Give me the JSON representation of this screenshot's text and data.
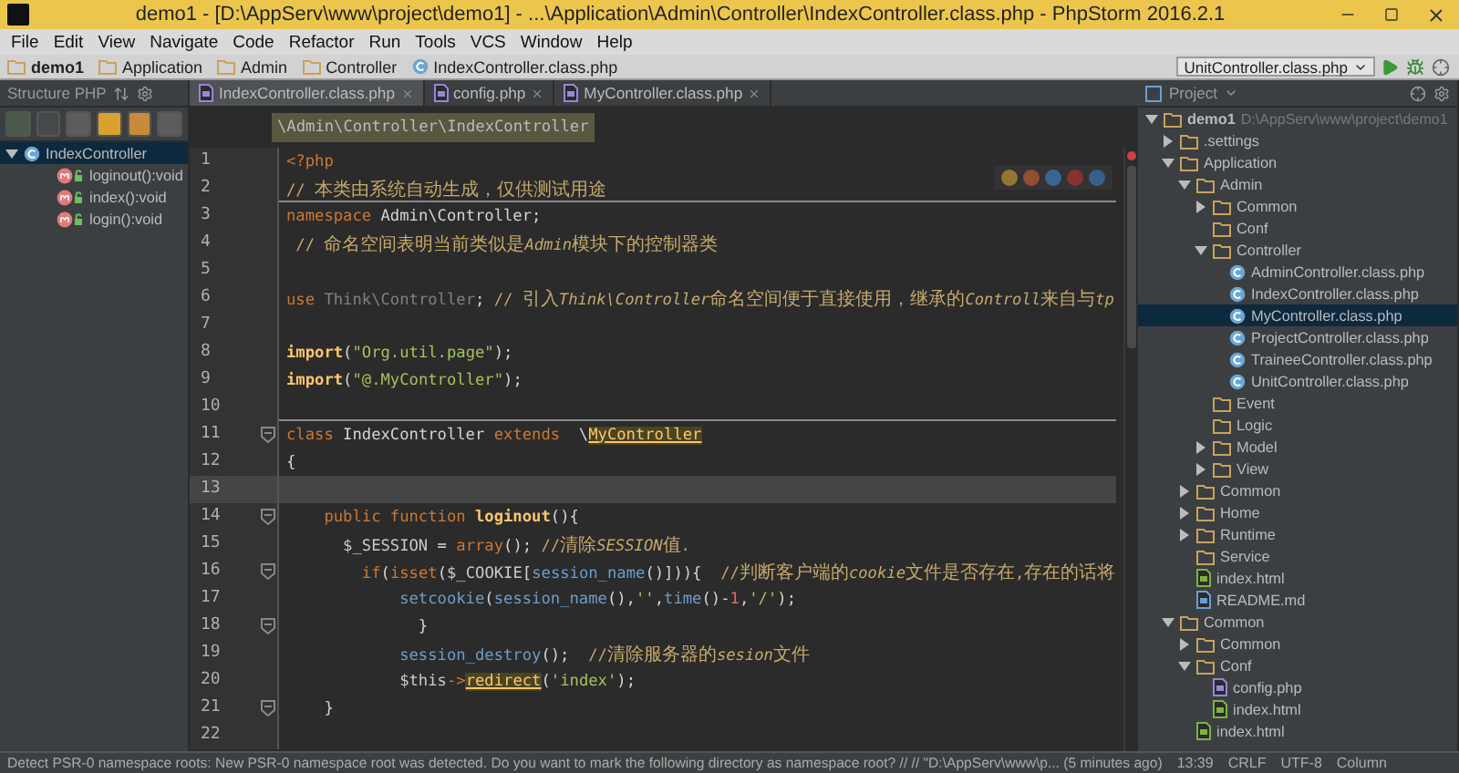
{
  "window": {
    "title": "demo1 - [D:\\AppServ\\www\\project\\demo1] - ...\\Application\\Admin\\Controller\\IndexController.class.php - PhpStorm 2016.2.1"
  },
  "menu": [
    "File",
    "Edit",
    "View",
    "Navigate",
    "Code",
    "Refactor",
    "Run",
    "Tools",
    "VCS",
    "Window",
    "Help"
  ],
  "navbar": {
    "crumbs": [
      {
        "label": "demo1",
        "kind": "project"
      },
      {
        "label": "Application",
        "kind": "folder"
      },
      {
        "label": "Admin",
        "kind": "folder"
      },
      {
        "label": "Controller",
        "kind": "folder"
      },
      {
        "label": "IndexController.class.php",
        "kind": "class"
      }
    ],
    "run_config": "UnitController.class.php"
  },
  "structure": {
    "title": "Structure PHP",
    "tree": [
      {
        "label": "IndexController",
        "kind": "class",
        "selected": true,
        "expanded": true,
        "children": [
          {
            "label": "loginout():void",
            "kind": "method",
            "selected": false
          },
          {
            "label": "index():void",
            "kind": "method",
            "selected": false
          },
          {
            "label": "login():void",
            "kind": "method",
            "selected": false
          }
        ]
      }
    ]
  },
  "editor": {
    "tabs": [
      {
        "label": "IndexController.class.php",
        "selected": true
      },
      {
        "label": "config.php",
        "selected": false
      },
      {
        "label": "MyController.class.php",
        "selected": false
      }
    ],
    "breadcrumb": "\\Admin\\Controller\\IndexController",
    "lines": [
      {
        "number": "1",
        "current": false,
        "fold": false,
        "separator": false,
        "segments": [
          {
            "kind": "tag",
            "text": "<?php"
          }
        ]
      },
      {
        "number": "2",
        "current": false,
        "fold": false,
        "separator": true,
        "segments": [
          {
            "kind": "comment",
            "text": "// 本类由系统自动生成，仅供测试用途"
          }
        ]
      },
      {
        "number": "3",
        "current": false,
        "fold": false,
        "separator": false,
        "segments": [
          {
            "kind": "keyword",
            "text": "namespace"
          },
          {
            "kind": "plain",
            "text": " Admin\\Controller;"
          }
        ]
      },
      {
        "number": "4",
        "current": false,
        "fold": false,
        "separator": false,
        "segments": [
          {
            "kind": "comment",
            "text": " // 命名空间表明当前类似是"
          },
          {
            "kind": "comment_italic",
            "text": "Admin"
          },
          {
            "kind": "comment",
            "text": "模块下的控制器类"
          }
        ]
      },
      {
        "number": "5",
        "current": false,
        "fold": false,
        "separator": false
      },
      {
        "number": "6",
        "current": false,
        "fold": false,
        "separator": false,
        "segments": [
          {
            "kind": "keyword",
            "text": "use"
          },
          {
            "kind": "dim",
            "text": " Think\\Controller"
          },
          {
            "kind": "plain",
            "text": "; "
          },
          {
            "kind": "comment",
            "text": "// 引入"
          },
          {
            "kind": "comment_italic",
            "text": "Think\\Controller"
          },
          {
            "kind": "comment",
            "text": "命名空间便于直接使用，继承的"
          },
          {
            "kind": "comment_italic",
            "text": "Controll"
          },
          {
            "kind": "comment",
            "text": "来自与"
          },
          {
            "kind": "comment_italic",
            "text": "tp"
          }
        ]
      },
      {
        "number": "7",
        "current": false,
        "fold": false,
        "separator": false
      },
      {
        "number": "8",
        "current": false,
        "fold": false,
        "separator": false,
        "segments": [
          {
            "kind": "func",
            "text": "import"
          },
          {
            "kind": "plain",
            "text": "("
          },
          {
            "kind": "string",
            "text": "\"Org.util.page\""
          },
          {
            "kind": "plain",
            "text": ");"
          }
        ]
      },
      {
        "number": "9",
        "current": false,
        "fold": false,
        "separator": false,
        "segments": [
          {
            "kind": "func",
            "text": "import"
          },
          {
            "kind": "plain",
            "text": "("
          },
          {
            "kind": "string",
            "text": "\"@.MyController\""
          },
          {
            "kind": "plain",
            "text": ");"
          }
        ]
      },
      {
        "number": "10",
        "current": false,
        "fold": false,
        "separator": true
      },
      {
        "number": "11",
        "current": false,
        "fold": true,
        "separator": false,
        "segments": [
          {
            "kind": "keyword",
            "text": "class"
          },
          {
            "kind": "plain",
            "text": " IndexController "
          },
          {
            "kind": "keyword",
            "text": "extends"
          },
          {
            "kind": "plain",
            "text": "  \\"
          },
          {
            "kind": "ref",
            "text": "MyController"
          }
        ]
      },
      {
        "number": "12",
        "current": false,
        "fold": false,
        "separator": false,
        "segments": [
          {
            "kind": "plain",
            "text": "{"
          }
        ]
      },
      {
        "number": "13",
        "current": true,
        "fold": false,
        "separator": false
      },
      {
        "number": "14",
        "current": false,
        "fold": true,
        "separator": false,
        "segments": [
          {
            "kind": "keyword",
            "text": "    public function "
          },
          {
            "kind": "func",
            "text": "loginout"
          },
          {
            "kind": "plain",
            "text": "(){"
          }
        ]
      },
      {
        "number": "15",
        "current": false,
        "fold": false,
        "separator": false,
        "segments": [
          {
            "kind": "var",
            "text": "      $_SESSION"
          },
          {
            "kind": "plain",
            "text": " = "
          },
          {
            "kind": "keyword",
            "text": "array"
          },
          {
            "kind": "plain",
            "text": "(); "
          },
          {
            "kind": "comment",
            "text": "//清除"
          },
          {
            "kind": "comment_italic",
            "text": "SESSION"
          },
          {
            "kind": "comment",
            "text": "值."
          }
        ]
      },
      {
        "number": "16",
        "current": false,
        "fold": true,
        "separator": false,
        "segments": [
          {
            "kind": "keyword",
            "text": "        if"
          },
          {
            "kind": "plain",
            "text": "("
          },
          {
            "kind": "keyword",
            "text": "isset"
          },
          {
            "kind": "plain",
            "text": "("
          },
          {
            "kind": "var",
            "text": "$_COOKIE"
          },
          {
            "kind": "plain",
            "text": "["
          },
          {
            "kind": "builtin",
            "text": "session_name"
          },
          {
            "kind": "plain",
            "text": "()])){  "
          },
          {
            "kind": "comment",
            "text": "//判断客户端的"
          },
          {
            "kind": "comment_italic",
            "text": "cookie"
          },
          {
            "kind": "comment",
            "text": "文件是否存在,存在的话将"
          }
        ]
      },
      {
        "number": "17",
        "current": false,
        "fold": false,
        "separator": false,
        "segments": [
          {
            "kind": "builtin",
            "text": "            setcookie"
          },
          {
            "kind": "plain",
            "text": "("
          },
          {
            "kind": "builtin",
            "text": "session_name"
          },
          {
            "kind": "plain",
            "text": "(),"
          },
          {
            "kind": "string",
            "text": "''"
          },
          {
            "kind": "plain",
            "text": ","
          },
          {
            "kind": "builtin",
            "text": "time"
          },
          {
            "kind": "plain",
            "text": "()-"
          },
          {
            "kind": "number",
            "text": "1"
          },
          {
            "kind": "plain",
            "text": ","
          },
          {
            "kind": "string",
            "text": "'/'"
          },
          {
            "kind": "plain",
            "text": ");"
          }
        ]
      },
      {
        "number": "18",
        "current": false,
        "fold": true,
        "separator": false,
        "segments": [
          {
            "kind": "plain",
            "text": "              }"
          }
        ]
      },
      {
        "number": "19",
        "current": false,
        "fold": false,
        "separator": false,
        "segments": [
          {
            "kind": "builtin",
            "text": "            session_destroy"
          },
          {
            "kind": "plain",
            "text": "();  "
          },
          {
            "kind": "comment",
            "text": "//清除服务器的"
          },
          {
            "kind": "comment_italic",
            "text": "sesion"
          },
          {
            "kind": "comment",
            "text": "文件"
          }
        ]
      },
      {
        "number": "20",
        "current": false,
        "fold": false,
        "separator": false,
        "segments": [
          {
            "kind": "var",
            "text": "            $this"
          },
          {
            "kind": "keyword",
            "text": "->"
          },
          {
            "kind": "ref",
            "text": "redirect"
          },
          {
            "kind": "plain",
            "text": "("
          },
          {
            "kind": "string",
            "text": "'index'"
          },
          {
            "kind": "plain",
            "text": ");"
          }
        ]
      },
      {
        "number": "21",
        "current": false,
        "fold": true,
        "separator": false,
        "segments": [
          {
            "kind": "plain",
            "text": "    }"
          }
        ]
      },
      {
        "number": "22",
        "current": false,
        "fold": false,
        "separator": false
      }
    ]
  },
  "project": {
    "title": "Project",
    "tree": [
      {
        "label": "demo1",
        "kind": "root",
        "path": "D:\\AppServ\\www\\project\\demo1",
        "expanded": true,
        "selected": false,
        "children": [
          {
            "label": ".settings",
            "kind": "folder",
            "expanded": false,
            "selected": false
          },
          {
            "label": "Application",
            "kind": "folder",
            "expanded": true,
            "selected": false,
            "children": [
              {
                "label": "Admin",
                "kind": "folder",
                "expanded": true,
                "selected": false,
                "children": [
                  {
                    "label": "Common",
                    "kind": "folder",
                    "expanded": false,
                    "selected": false
                  },
                  {
                    "label": "Conf",
                    "kind": "folder",
                    "selected": false
                  },
                  {
                    "label": "Controller",
                    "kind": "folder",
                    "expanded": true,
                    "selected": false,
                    "children": [
                      {
                        "label": "AdminController.class.php",
                        "kind": "class",
                        "selected": false
                      },
                      {
                        "label": "IndexController.class.php",
                        "kind": "class",
                        "selected": false
                      },
                      {
                        "label": "MyController.class.php",
                        "kind": "class",
                        "selected": true
                      },
                      {
                        "label": "ProjectController.class.php",
                        "kind": "class",
                        "selected": false
                      },
                      {
                        "label": "TraineeController.class.php",
                        "kind": "class",
                        "selected": false
                      },
                      {
                        "label": "UnitController.class.php",
                        "kind": "class",
                        "selected": false
                      }
                    ]
                  },
                  {
                    "label": "Event",
                    "kind": "folder",
                    "selected": false
                  },
                  {
                    "label": "Logic",
                    "kind": "folder",
                    "selected": false
                  },
                  {
                    "label": "Model",
                    "kind": "folder",
                    "expanded": false,
                    "selected": false
                  },
                  {
                    "label": "View",
                    "kind": "folder",
                    "expanded": false,
                    "selected": false
                  }
                ]
              },
              {
                "label": "Common",
                "kind": "folder",
                "expanded": false,
                "selected": false
              },
              {
                "label": "Home",
                "kind": "folder",
                "expanded": false,
                "selected": false
              },
              {
                "label": "Runtime",
                "kind": "folder",
                "expanded": false,
                "selected": false
              },
              {
                "label": "Service",
                "kind": "folder",
                "selected": false
              },
              {
                "label": "index.html",
                "kind": "html",
                "selected": false
              },
              {
                "label": "README.md",
                "kind": "md",
                "selected": false
              }
            ]
          },
          {
            "label": "Common",
            "kind": "folder",
            "expanded": true,
            "selected": false,
            "children": [
              {
                "label": "Common",
                "kind": "folder",
                "expanded": false,
                "selected": false
              },
              {
                "label": "Conf",
                "kind": "folder",
                "expanded": true,
                "selected": false,
                "children": [
                  {
                    "label": "config.php",
                    "kind": "php",
                    "selected": false
                  },
                  {
                    "label": "index.html",
                    "kind": "html",
                    "selected": false
                  }
                ]
              },
              {
                "label": "index.html",
                "kind": "html",
                "selected": false
              }
            ]
          }
        ]
      }
    ]
  },
  "status_bar": {
    "message": "Detect PSR-0 namespace roots: New PSR-0 namespace root was detected. Do you want to mark the following directory as namespace root? // // \"D:\\AppServ\\www\\p... (5 minutes ago)",
    "position": "13:39",
    "line_separator": "CRLF",
    "encoding": "UTF-8",
    "column": "Column"
  }
}
